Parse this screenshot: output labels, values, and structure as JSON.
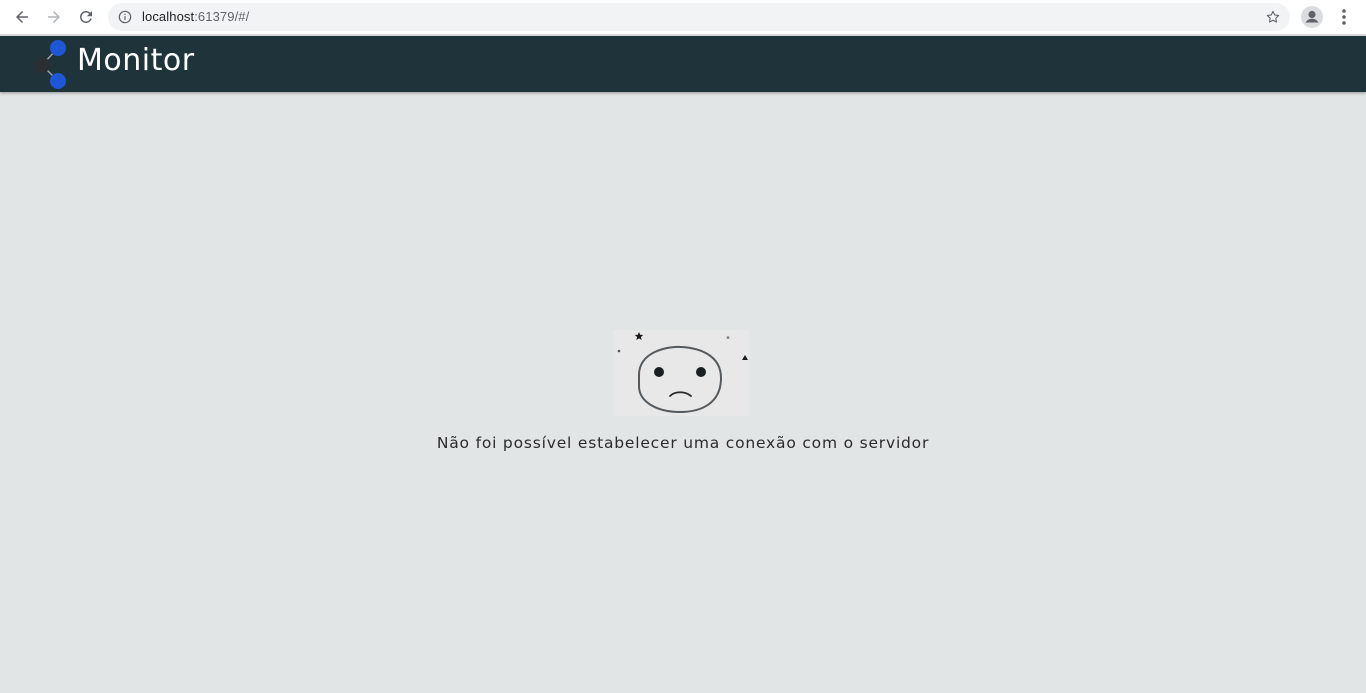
{
  "browser": {
    "url_host": "localhost",
    "url_rest": ":61379/#/",
    "back_icon": "arrow-back-icon",
    "forward_icon": "arrow-forward-icon",
    "reload_icon": "reload-icon",
    "info_icon": "info-icon",
    "star_icon": "star-icon",
    "profile_icon": "profile-icon",
    "menu_icon": "kebab-menu-icon"
  },
  "header": {
    "title": "Monitor",
    "background": "#1f333b",
    "logo_accent": "#1e56d6"
  },
  "main": {
    "illustration": "sad-face-icon",
    "message": "Não foi possível estabelecer uma conexão com o servidor"
  }
}
